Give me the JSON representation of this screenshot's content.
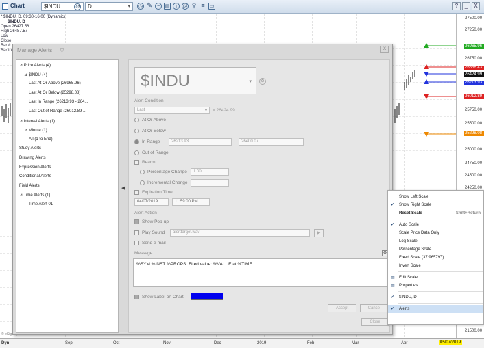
{
  "toolbar": {
    "title": "Chart",
    "symbol": "$INDU",
    "interval": "D",
    "win_btns": [
      "?",
      "_",
      "X"
    ]
  },
  "datawindow": {
    "header": "* $INDU, D, 09:30-16:00 (Dynamic)",
    "symbol": "$INDU, D",
    "rows": [
      [
        "Open",
        "26427.56"
      ],
      [
        "High",
        "26487.57"
      ],
      [
        "Low",
        ""
      ],
      [
        "Close",
        ""
      ],
      [
        "Bar #",
        ""
      ],
      [
        "Bar Index",
        ""
      ]
    ]
  },
  "price_scale": {
    "ticks": [
      "27500.00",
      "27250.00",
      "26750.00",
      "25750.00",
      "25500.00",
      "25000.00",
      "24750.00",
      "24500.00",
      "24250.00",
      "21500.00"
    ],
    "badges": [
      {
        "text": "26965.96",
        "color": "#22aa22"
      },
      {
        "text": "26556.43",
        "color": "#dd2222"
      },
      {
        "text": "26424.99",
        "color": "#111111"
      },
      {
        "text": "26213.93",
        "color": "#2233dd"
      },
      {
        "text": "26012.89",
        "color": "#dd2222"
      },
      {
        "text": "25298.08",
        "color": "#ee8800"
      }
    ]
  },
  "x_axis": {
    "left": "Dyn",
    "labels": [
      "Sep",
      "Oct",
      "Nov",
      "Dec",
      "2019",
      "Feb",
      "Mar",
      "Apr"
    ],
    "highlight": "05/07/2019",
    "copyright": "© eSignal, 2019"
  },
  "dialog": {
    "title": "Manage Alerts",
    "close": "X",
    "tree": [
      {
        "t": "⊿ Price Alerts (4)",
        "lvl": 0
      },
      {
        "t": "⊿ $INDU (4)",
        "lvl": 1
      },
      {
        "t": "Last At Or Above (26965.96)",
        "lvl": 2
      },
      {
        "t": "Last At Or Below (25298.08)",
        "lvl": 2
      },
      {
        "t": "Last In Range (26213.93 - 264...",
        "lvl": 2
      },
      {
        "t": "Last Out of Range (26012.89 ...",
        "lvl": 2
      },
      {
        "t": "⊿ Interval Alerts (1)",
        "lvl": 0
      },
      {
        "t": "⊿ Minute (1)",
        "lvl": 1
      },
      {
        "t": "All (1 to End)",
        "lvl": 2
      },
      {
        "t": "Study Alerts",
        "lvl": 0
      },
      {
        "t": "Drawing Alerts",
        "lvl": 0
      },
      {
        "t": "Expression Alerts",
        "lvl": 0
      },
      {
        "t": "Conditional Alerts",
        "lvl": 0
      },
      {
        "t": "Field Alerts",
        "lvl": 0
      },
      {
        "t": "⊿ Time Alerts (1)",
        "lvl": 0
      },
      {
        "t": "Time Alert 01",
        "lvl": 2
      }
    ],
    "symbol": "$INDU",
    "alert_condition": "Alert Condition",
    "condition_field": "Last",
    "equals": "= 26424.99",
    "radios": [
      "At Or Above",
      "At Or Below",
      "In Range",
      "Out of Range"
    ],
    "range_lo": "26213.93",
    "range_sep": "-",
    "range_hi": "26400.07",
    "rearm": "Rearm",
    "pct_change": "Percentage Change",
    "pct_value": "1.00",
    "inc_change": "Incremental Change",
    "expiration": "Expiration Time",
    "exp_date": "04/07/2019",
    "exp_time": "11:59:00 PM",
    "alert_action": "Alert Action",
    "show_popup": "Show Pop-up",
    "play_sound": "Play Sound",
    "sound_file": "alerttarget.wav",
    "send_email": "Send e-mail",
    "message_label": "Message",
    "message": "%SYM %INST %PROPS. Fired value: %VALUE at %TIME",
    "show_label": "Show Label on Chart",
    "label_color": "#0000ee",
    "accept": "Accept",
    "cancel": "Cancel",
    "close_btn": "Close"
  },
  "menu": {
    "items": [
      {
        "label": "Show Left Scale",
        "check": false,
        "bold": false
      },
      {
        "label": "Show Right Scale",
        "check": true,
        "bold": false
      },
      {
        "label": "Reset Scale",
        "check": false,
        "bold": true,
        "shortcut": "Shift+Return"
      },
      {
        "sep": true
      },
      {
        "label": "Auto Scale",
        "check": true
      },
      {
        "label": "Scale Price Data Only",
        "check": false
      },
      {
        "label": "Log Scale",
        "check": false
      },
      {
        "label": "Percentage Scale",
        "check": false
      },
      {
        "label": "Fixed Scale (37.965797)",
        "check": false
      },
      {
        "label": "Invert Scale",
        "check": false
      },
      {
        "sep": true
      },
      {
        "label": "Edit Scale...",
        "check": false,
        "icon": true
      },
      {
        "label": "Properties...",
        "check": false,
        "icon": true
      },
      {
        "sep": true
      },
      {
        "label": "$INDU, D",
        "check": true
      },
      {
        "sep": true
      },
      {
        "label": "Alerts",
        "check": true,
        "selected": true
      }
    ]
  }
}
